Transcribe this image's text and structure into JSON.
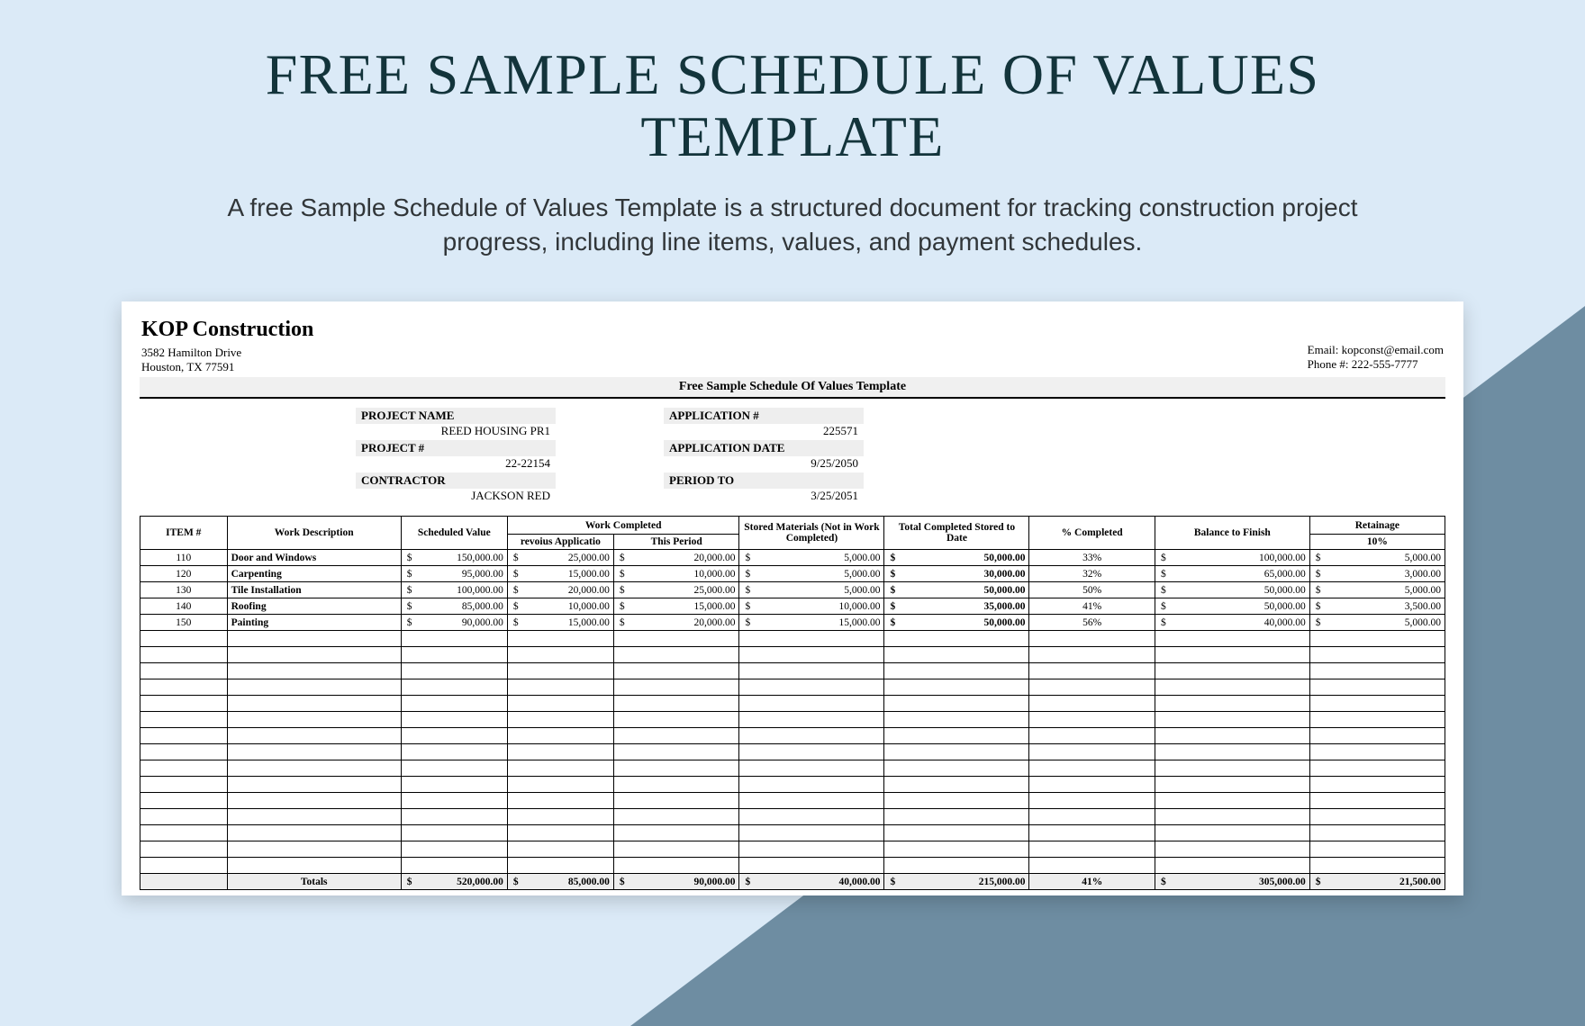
{
  "hero": {
    "title": "FREE SAMPLE SCHEDULE OF VALUES TEMPLATE",
    "desc": "A free Sample Schedule of Values Template is a structured document for tracking construction project progress, including line items, values, and payment schedules."
  },
  "company": {
    "name": "KOP Construction",
    "addr1": "3582 Hamilton Drive",
    "addr2": "Houston, TX 77591",
    "email": "Email: kopconst@email.com",
    "phone": "Phone #: 222-555-7777"
  },
  "barTitle": "Free Sample Schedule Of Values Template",
  "meta": {
    "left": [
      {
        "lbl": "PROJECT NAME",
        "val": "REED HOUSING PR1"
      },
      {
        "lbl": "PROJECT #",
        "val": "22-22154"
      },
      {
        "lbl": "CONTRACTOR",
        "val": "JACKSON RED"
      }
    ],
    "right": [
      {
        "lbl": "APPLICATION #",
        "val": "225571"
      },
      {
        "lbl": "APPLICATION DATE",
        "val": "9/25/2050"
      },
      {
        "lbl": "PERIOD TO",
        "val": "3/25/2051"
      }
    ]
  },
  "cols": {
    "item": "ITEM #",
    "desc": "Work Description",
    "sched": "Scheduled Value",
    "wc": "Work Completed",
    "prev": "revoius Applicatio",
    "this": "This Period",
    "stored": "Stored Materials (Not in Work Completed)",
    "tot": "Total Completed Stored to Date",
    "pct": "% Completed",
    "bal": "Balance to Finish",
    "ret": "Retainage",
    "retSub": "10%"
  },
  "rows": [
    {
      "item": "110",
      "desc": "Door and Windows",
      "sched": "150,000.00",
      "prev": "25,000.00",
      "this": "20,000.00",
      "stored": "5,000.00",
      "tot": "50,000.00",
      "pct": "33%",
      "bal": "100,000.00",
      "ret": "5,000.00"
    },
    {
      "item": "120",
      "desc": "Carpenting",
      "sched": "95,000.00",
      "prev": "15,000.00",
      "this": "10,000.00",
      "stored": "5,000.00",
      "tot": "30,000.00",
      "pct": "32%",
      "bal": "65,000.00",
      "ret": "3,000.00"
    },
    {
      "item": "130",
      "desc": "Tile Installation",
      "sched": "100,000.00",
      "prev": "20,000.00",
      "this": "25,000.00",
      "stored": "5,000.00",
      "tot": "50,000.00",
      "pct": "50%",
      "bal": "50,000.00",
      "ret": "5,000.00"
    },
    {
      "item": "140",
      "desc": "Roofing",
      "sched": "85,000.00",
      "prev": "10,000.00",
      "this": "15,000.00",
      "stored": "10,000.00",
      "tot": "35,000.00",
      "pct": "41%",
      "bal": "50,000.00",
      "ret": "3,500.00"
    },
    {
      "item": "150",
      "desc": "Painting",
      "sched": "90,000.00",
      "prev": "15,000.00",
      "this": "20,000.00",
      "stored": "15,000.00",
      "tot": "50,000.00",
      "pct": "56%",
      "bal": "40,000.00",
      "ret": "5,000.00"
    }
  ],
  "blankRows": 15,
  "totals": {
    "label": "Totals",
    "sched": "520,000.00",
    "prev": "85,000.00",
    "this": "90,000.00",
    "stored": "40,000.00",
    "tot": "215,000.00",
    "pct": "41%",
    "bal": "305,000.00",
    "ret": "21,500.00"
  }
}
